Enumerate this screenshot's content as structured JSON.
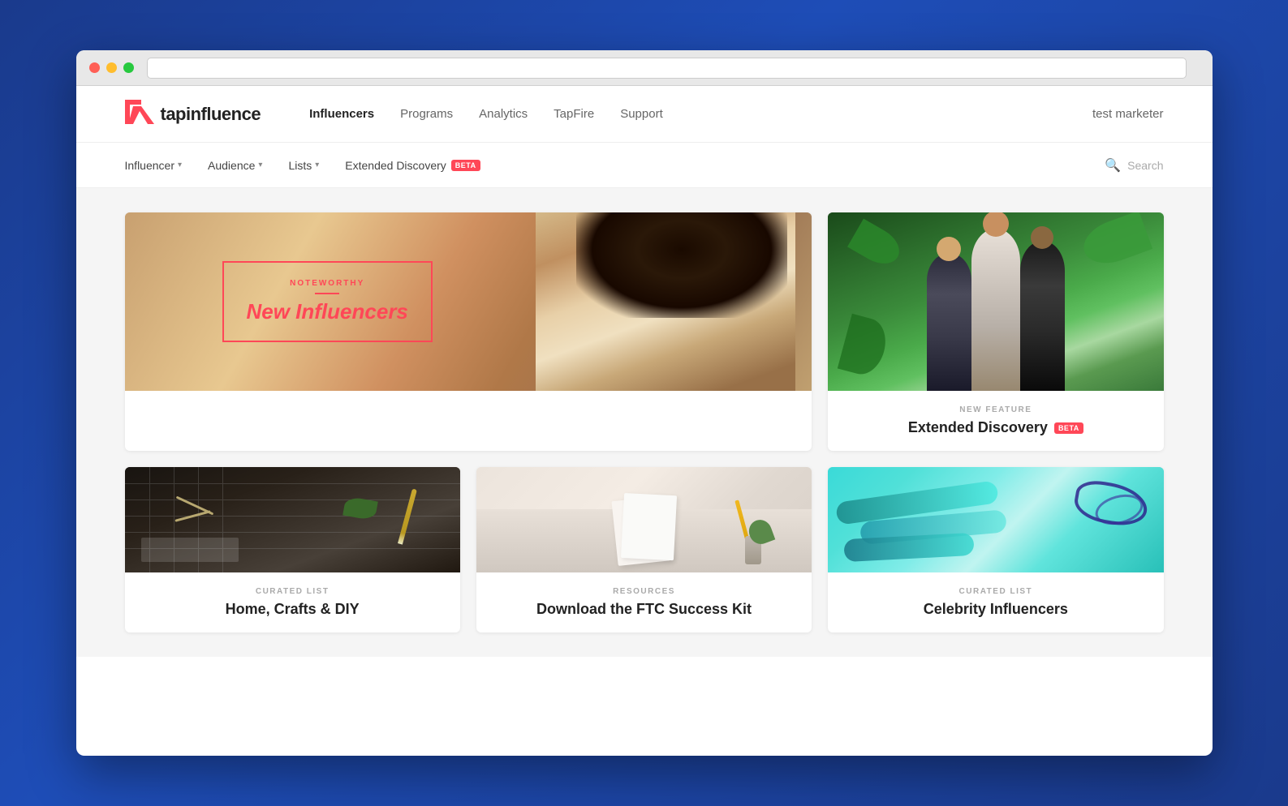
{
  "browser": {
    "dots": [
      "red",
      "yellow",
      "green"
    ]
  },
  "nav": {
    "logo_text": "tapinfluence",
    "links": [
      {
        "id": "influencers",
        "label": "Influencers",
        "active": true
      },
      {
        "id": "programs",
        "label": "Programs",
        "active": false
      },
      {
        "id": "analytics",
        "label": "Analytics",
        "active": false
      },
      {
        "id": "tapfire",
        "label": "TapFire",
        "active": false
      },
      {
        "id": "support",
        "label": "Support",
        "active": false
      }
    ],
    "user_label": "test marketer"
  },
  "sub_nav": {
    "items": [
      {
        "id": "influencer",
        "label": "Influencer",
        "has_dropdown": true
      },
      {
        "id": "audience",
        "label": "Audience",
        "has_dropdown": true
      },
      {
        "id": "lists",
        "label": "Lists",
        "has_dropdown": true
      },
      {
        "id": "extended-discovery",
        "label": "Extended Discovery",
        "has_badge": true,
        "badge_text": "BETA"
      }
    ],
    "search_placeholder": "Search"
  },
  "cards": {
    "hero": {
      "tag_label": "NOTEWORTHY",
      "title": "New Influencers"
    },
    "feature": {
      "label": "NEW FEATURE",
      "title": "Extended Discovery",
      "badge_text": "BETA"
    },
    "small": [
      {
        "label": "CURATED LIST",
        "title": "Home, Crafts & DIY"
      },
      {
        "label": "RESOURCES",
        "title": "Download the FTC Success Kit"
      },
      {
        "label": "CURATED LIST",
        "title": "Celebrity Influencers"
      }
    ]
  }
}
